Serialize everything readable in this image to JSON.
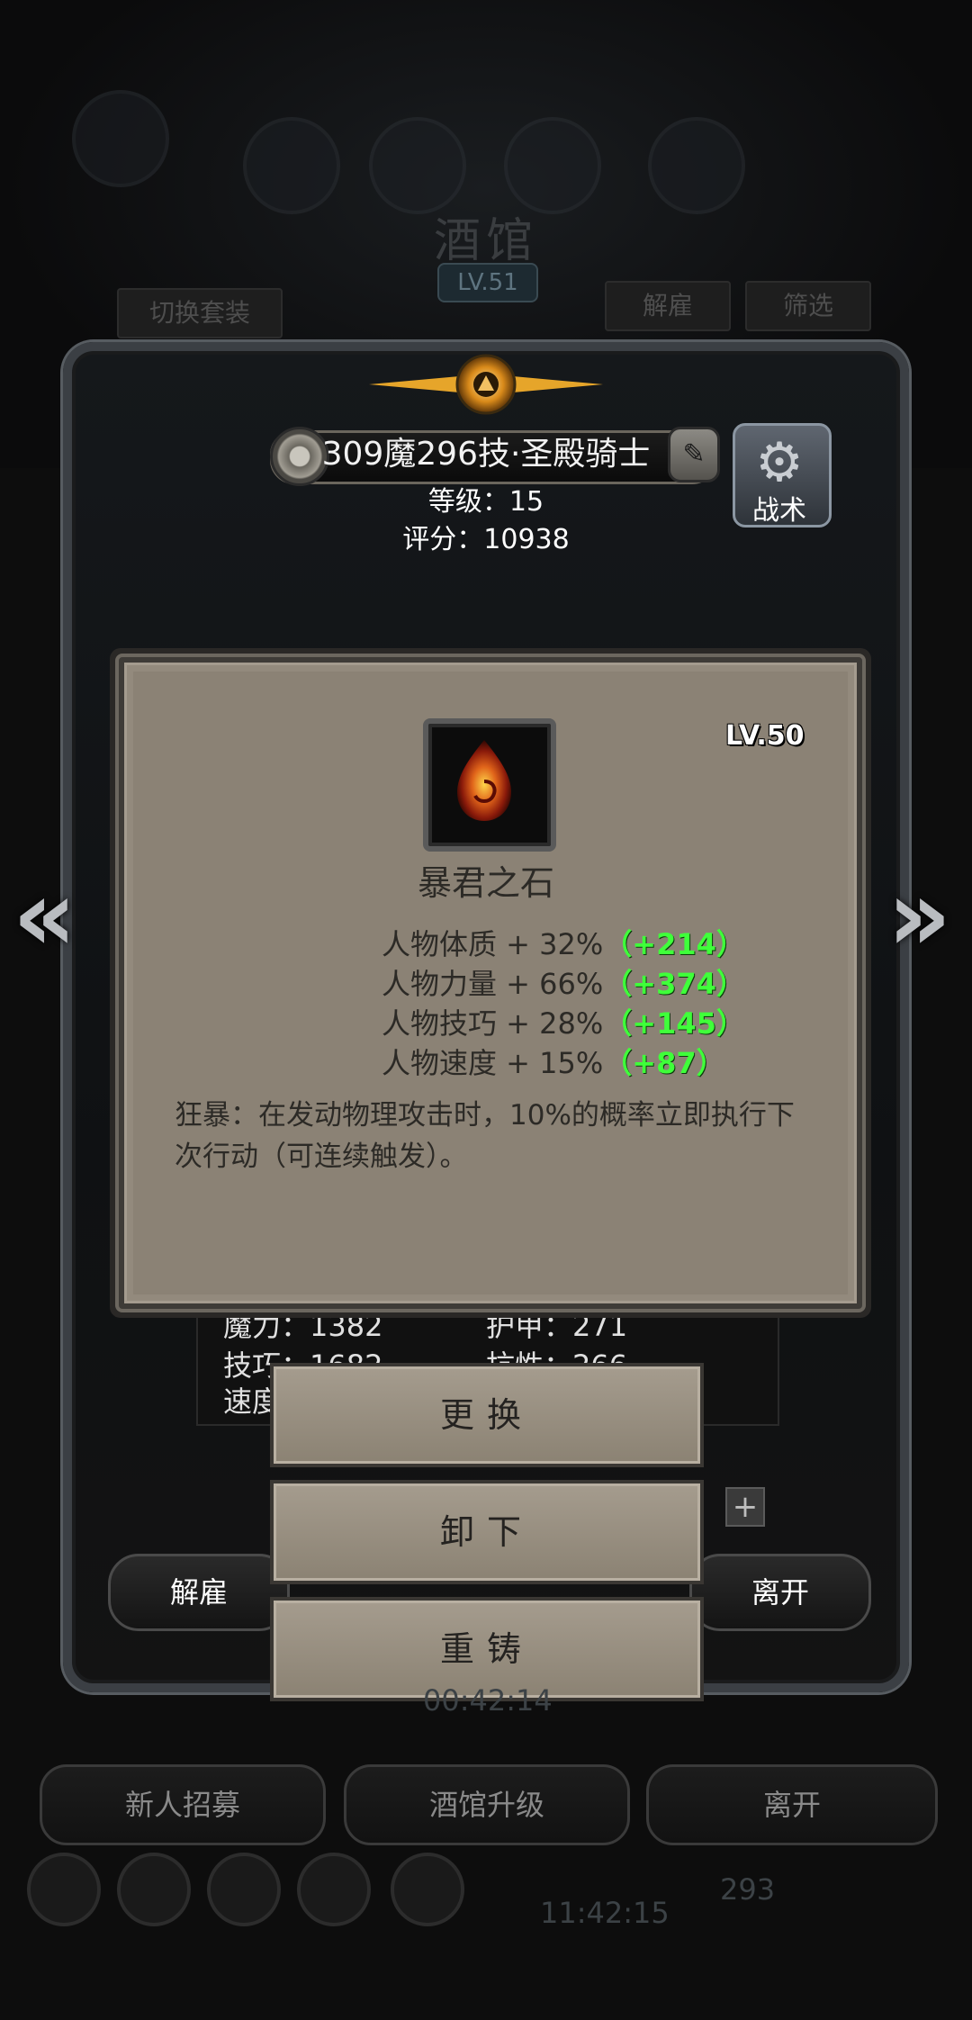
{
  "background": {
    "tavern_title": "酒馆",
    "tavern_level": "LV.51",
    "switch_set_label": "切换套装",
    "dismiss_label": "解雇",
    "filter_label": "筛选",
    "timer_center": "00:42:14",
    "timer_bottom": "11:42:15",
    "currency": "293"
  },
  "hero": {
    "name": "309魔296技·圣殿骑士",
    "level": "等级：15",
    "score": "评分：10938",
    "tactics_label": "战术"
  },
  "stats": {
    "magic": "魔力：1382",
    "armor": "护甲：271",
    "skill": "技巧：1682",
    "resist": "抗性：266",
    "speed": "速度"
  },
  "item": {
    "level": "LV.50",
    "name": "暴君之石",
    "attributes": [
      {
        "label": "人物体质 + 32%",
        "bonus": "（+214）"
      },
      {
        "label": "人物力量 + 66%",
        "bonus": "（+374）"
      },
      {
        "label": "人物技巧 + 28%",
        "bonus": "（+145）"
      },
      {
        "label": "人物速度 + 15%",
        "bonus": "（+87）"
      }
    ],
    "description": "狂暴：在发动物理攻击时，10%的概率立即执行下次行动（可连续触发）。"
  },
  "actions": {
    "replace": "更换",
    "unequip": "卸下",
    "reforge": "重铸"
  },
  "panel_buttons": {
    "dismiss": "解雇",
    "leave": "离开"
  },
  "bottom_bar": {
    "recruit": "新人招募",
    "upgrade": "酒馆升级",
    "leave": "离开"
  },
  "colors": {
    "popup_bg": "#8b8275",
    "bonus_green": "#3fff3a"
  }
}
